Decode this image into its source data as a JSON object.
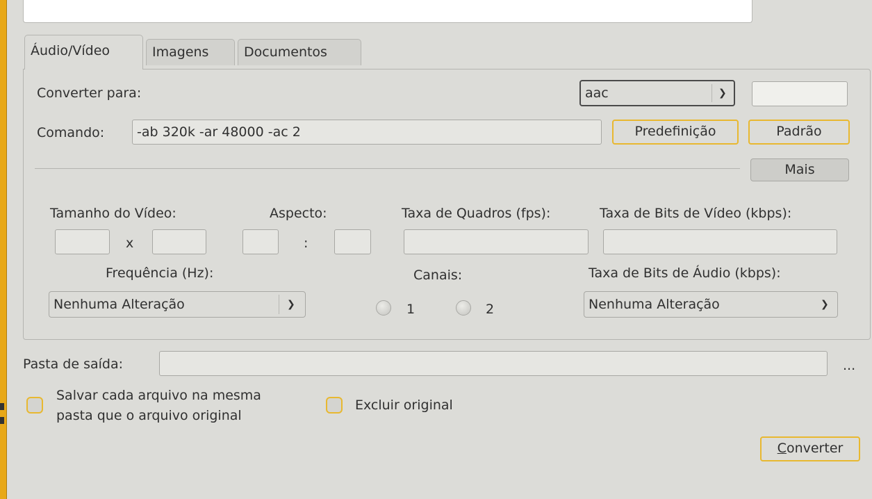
{
  "tabs": [
    "Áudio/Vídeo",
    "Imagens",
    "Documentos"
  ],
  "convert_to": {
    "label": "Converter para:",
    "format": "aac"
  },
  "command": {
    "label": "Comando:",
    "value": "-ab 320k -ar 48000 -ac 2",
    "preset_button": "Predefinição",
    "default_button": "Padrão",
    "more_button": "Mais"
  },
  "video": {
    "size_label": "Tamanho do Vídeo:",
    "size_sep": "x",
    "aspect_label": "Aspecto:",
    "aspect_sep": ":",
    "fps_label": "Taxa de Quadros (fps):",
    "bitrate_label": "Taxa de Bits de Vídeo (kbps):"
  },
  "audio": {
    "frequency_label": "Frequência (Hz):",
    "frequency_value": "Nenhuma Alteração",
    "channels_label": "Canais:",
    "channel_options": [
      "1",
      "2"
    ],
    "bitrate_label": "Taxa de Bits de Áudio (kbps):",
    "bitrate_value": "Nenhuma Alteração"
  },
  "output": {
    "label": "Pasta de saída:",
    "value": "",
    "browse": "..."
  },
  "options": {
    "same_folder_line1": "Salvar cada arquivo na mesma",
    "same_folder_line2": "pasta que o arquivo original",
    "delete_original": "Excluir original"
  },
  "convert_button": {
    "mnemonic": "C",
    "rest": "onverter"
  },
  "colors": {
    "accent": "#e8b830",
    "background": "#dcdcd8"
  }
}
